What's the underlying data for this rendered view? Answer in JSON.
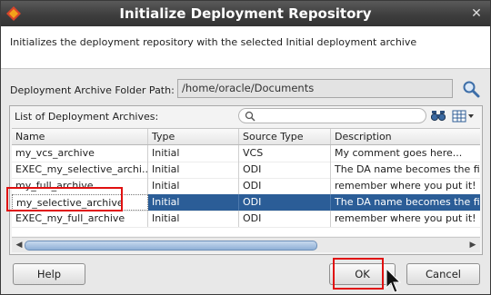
{
  "window": {
    "title": "Initialize Deployment Repository"
  },
  "header": {
    "description": "Initializes the deployment repository with the selected Initial deployment archive"
  },
  "path": {
    "label": "Deployment Archive Folder Path:",
    "value": "/home/oracle/Documents"
  },
  "list": {
    "label": "List of Deployment Archives:",
    "filter_placeholder": "",
    "columns": [
      "Name",
      "Type",
      "Source Type",
      "Description"
    ],
    "rows": [
      [
        "my_vcs_archive",
        "Initial",
        "VCS",
        "My comment goes here..."
      ],
      [
        "EXEC_my_selective_archi...",
        "Initial",
        "ODI",
        "The DA name becomes the file"
      ],
      [
        "my_full_archive",
        "Initial",
        "ODI",
        "remember where you put it!"
      ],
      [
        "my_selective_archive",
        "Initial",
        "ODI",
        "The DA name becomes the file"
      ],
      [
        "EXEC_my_full_archive",
        "Initial",
        "ODI",
        "remember where you put it!"
      ]
    ],
    "selected_index": 3
  },
  "buttons": {
    "help": "Help",
    "ok": "OK",
    "cancel": "Cancel"
  },
  "icons": {
    "app": "oracle-logo-icon",
    "close": "close-icon",
    "browse": "search-icon",
    "filter": "search-icon",
    "find": "binoculars-icon",
    "columns": "columns-icon"
  },
  "colors": {
    "selection": "#2b5d97",
    "highlight": "#e01010"
  }
}
